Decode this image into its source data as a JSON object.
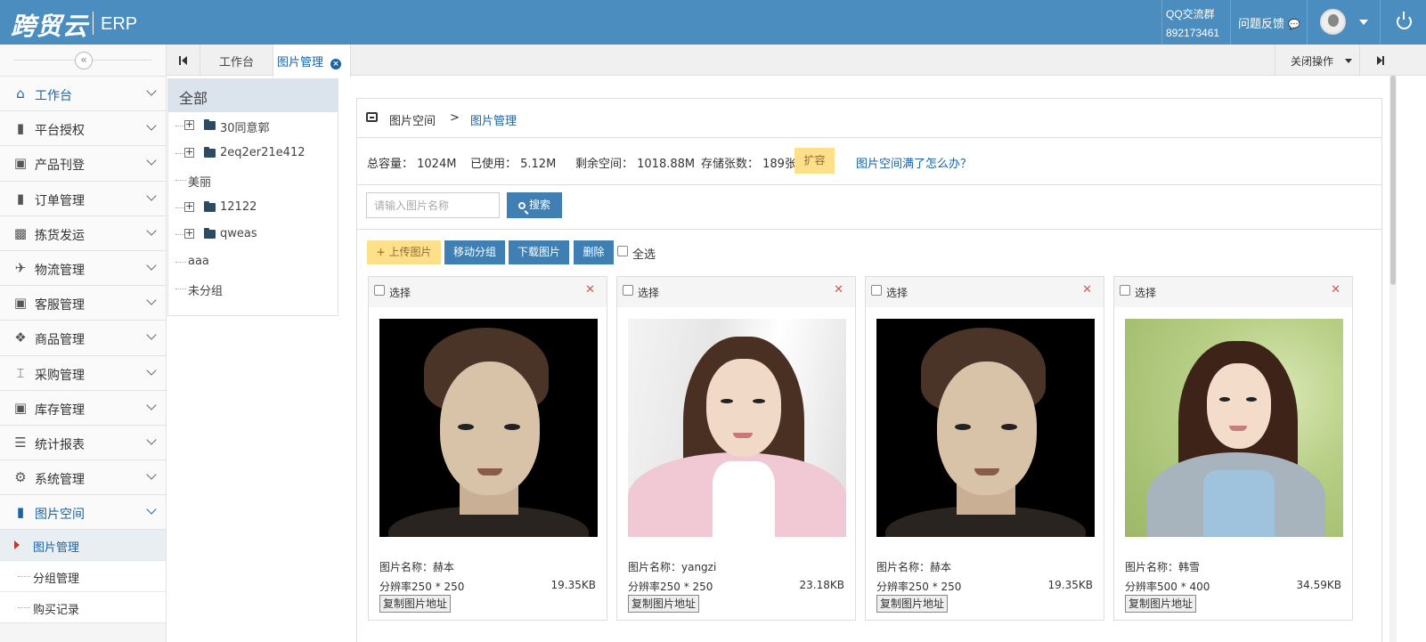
{
  "header": {
    "logo": "跨贸云",
    "product": "ERP",
    "qq_label": "QQ交流群",
    "qq_number": "892173461",
    "feedback": "问题反馈"
  },
  "sidebar": {
    "items": [
      {
        "label": "工作台",
        "icon": "home-icon"
      },
      {
        "label": "平台授权",
        "icon": "bookmark-icon"
      },
      {
        "label": "产品刊登",
        "icon": "cube-icon"
      },
      {
        "label": "订单管理",
        "icon": "file-icon"
      },
      {
        "label": "拣货发运",
        "icon": "truck-icon"
      },
      {
        "label": "物流管理",
        "icon": "plane-icon"
      },
      {
        "label": "客服管理",
        "icon": "briefcase-icon"
      },
      {
        "label": "商品管理",
        "icon": "gift-icon"
      },
      {
        "label": "采购管理",
        "icon": "cart-icon"
      },
      {
        "label": "库存管理",
        "icon": "inbox-icon"
      },
      {
        "label": "统计报表",
        "icon": "list-icon"
      },
      {
        "label": "系统管理",
        "icon": "gear-icon"
      },
      {
        "label": "图片空间",
        "icon": "file-icon"
      }
    ],
    "subitems": [
      {
        "label": "图片管理"
      },
      {
        "label": "分组管理"
      },
      {
        "label": "购买记录"
      }
    ]
  },
  "tabs": {
    "items": [
      {
        "label": "工作台"
      },
      {
        "label": "图片管理"
      }
    ],
    "close_ops": "关闭操作"
  },
  "tree": {
    "title": "全部",
    "nodes": [
      {
        "label": "30同意郭",
        "folder": true
      },
      {
        "label": "2eq2er21e412",
        "folder": true
      },
      {
        "label": "美丽",
        "folder": false
      },
      {
        "label": "12122",
        "folder": true
      },
      {
        "label": "qweas",
        "folder": true
      },
      {
        "label": "aaa",
        "folder": false
      },
      {
        "label": "未分组",
        "folder": false
      }
    ]
  },
  "breadcrumb": {
    "root": "图片空间",
    "sep": ">",
    "current": "图片管理"
  },
  "stats": {
    "total": "总容量： 1024M",
    "used": "已使用： 5.12M",
    "remaining": "剩余空间： 1018.88M",
    "count": "存储张数： 189张",
    "expand": "扩容",
    "help": "图片空间满了怎么办？"
  },
  "search": {
    "placeholder": "请输入图片名称",
    "button": "搜索"
  },
  "actions": {
    "upload": "上传图片",
    "move": "移动分组",
    "download": "下载图片",
    "delete": "删除",
    "select_all": "全选"
  },
  "cards": [
    {
      "select": "选择",
      "name": "图片名称：赫本",
      "resolution": "分辨率250 * 250",
      "size": "19.35KB",
      "copy": "复制图片地址"
    },
    {
      "select": "选择",
      "name": "图片名称：yangzi",
      "resolution": "分辨率250 * 250",
      "size": "23.18KB",
      "copy": "复制图片地址"
    },
    {
      "select": "选择",
      "name": "图片名称：赫本",
      "resolution": "分辨率250 * 250",
      "size": "19.35KB",
      "copy": "复制图片地址"
    },
    {
      "select": "选择",
      "name": "图片名称：韩雪",
      "resolution": "分辨率500 * 400",
      "size": "34.59KB",
      "copy": "复制图片地址"
    }
  ],
  "colors": {
    "header": "#4a8dbe",
    "accent": "#1a63a5",
    "button": "#3f7fb3",
    "warning": "#ffe08a"
  }
}
